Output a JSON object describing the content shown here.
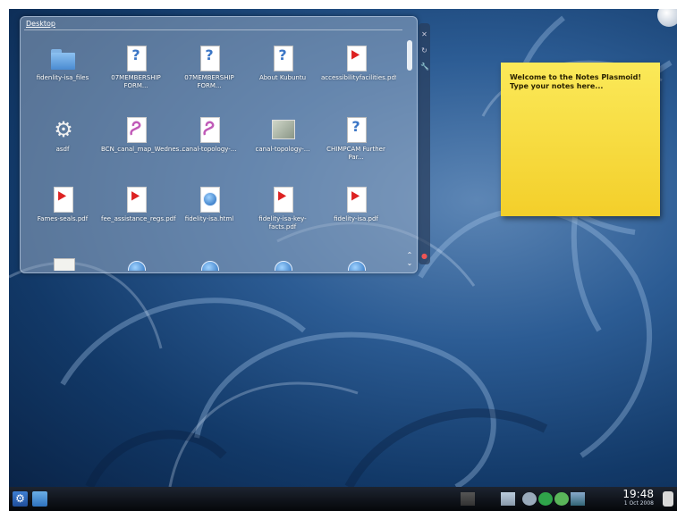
{
  "folder_view": {
    "title": "Desktop",
    "items": [
      {
        "label": "fidenlity-isa_files",
        "icon": "folder-icon"
      },
      {
        "label": "07MEMBERSHIP FORM...",
        "icon": "unknown-doc-icon"
      },
      {
        "label": "07MEMBERSHIP FORM...",
        "icon": "unknown-doc-icon"
      },
      {
        "label": "About Kubuntu",
        "icon": "unknown-doc-icon"
      },
      {
        "label": "accessibilityfacilities.pdf",
        "icon": "pdf-icon"
      },
      {
        "label": "asdf",
        "icon": "gear-icon"
      },
      {
        "label": "BCN_canal_map_Wednes...",
        "icon": "svg-icon"
      },
      {
        "label": "canal-topology-...",
        "icon": "svg-icon"
      },
      {
        "label": "canal-topology-...",
        "icon": "map-icon"
      },
      {
        "label": "CHIMPCAM Further Par...",
        "icon": "unknown-doc-icon"
      },
      {
        "label": "Fames-seals.pdf",
        "icon": "pdf-icon"
      },
      {
        "label": "fee_assistance_regs.pdf",
        "icon": "pdf-icon"
      },
      {
        "label": "fidelity-isa.html",
        "icon": "html-icon"
      },
      {
        "label": "fidelity-isa-key-facts.pdf",
        "icon": "pdf-icon"
      },
      {
        "label": "fidelity-isa.pdf",
        "icon": "pdf-icon"
      },
      {
        "label": "",
        "icon": "text-doc-icon"
      },
      {
        "label": "",
        "icon": "globe-icon"
      },
      {
        "label": "",
        "icon": "globe-icon"
      },
      {
        "label": "",
        "icon": "globe-icon"
      },
      {
        "label": "",
        "icon": "globe-icon"
      }
    ]
  },
  "note": {
    "line1": "Welcome to the Notes Plasmoid!",
    "line2": "Type your notes here..."
  },
  "taskbar": {
    "clock_time": "19:48",
    "clock_date": "1 Oct 2008"
  }
}
